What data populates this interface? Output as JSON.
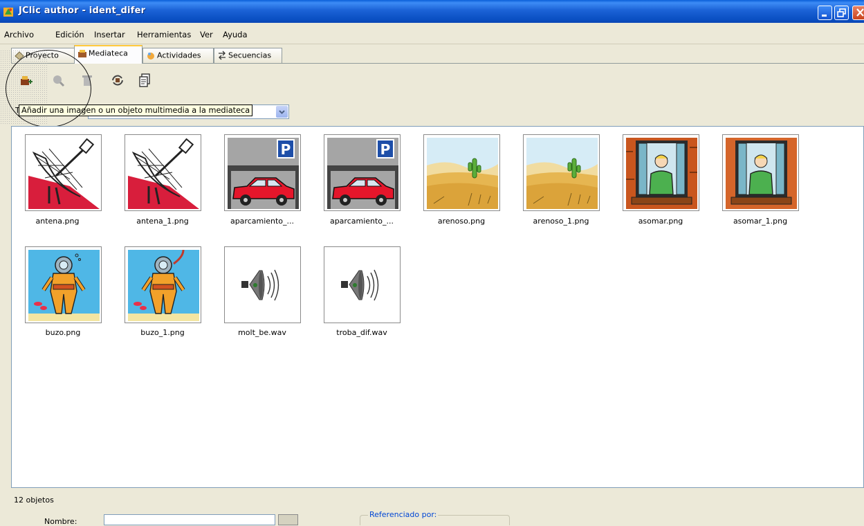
{
  "window": {
    "title": "JClic author - ident_difer"
  },
  "menu": [
    "Archivo",
    "Edición",
    "Insertar",
    "Herramientas",
    "Ver",
    "Ayuda"
  ],
  "tabs": [
    {
      "label": "Proyecto",
      "icon": "project-icon"
    },
    {
      "label": "Mediateca",
      "icon": "media-library-icon",
      "active": true
    },
    {
      "label": "Actividades",
      "icon": "activities-icon"
    },
    {
      "label": "Secuencias",
      "icon": "sequences-icon"
    }
  ],
  "toolbar": {
    "tooltip": "Añadir una imagen o un objeto multimedia a la mediateca",
    "partial_label": "T",
    "tools": [
      "add-media-icon",
      "preview-icon",
      "delete-icon",
      "update-icon",
      "copy-icon"
    ]
  },
  "filter": {
    "selected": ""
  },
  "media": [
    {
      "name": "antena.png",
      "kind": "antenna"
    },
    {
      "name": "antena_1.png",
      "kind": "antenna"
    },
    {
      "name": "aparcamiento_...",
      "kind": "parking"
    },
    {
      "name": "aparcamiento_...",
      "kind": "parking"
    },
    {
      "name": "arenoso.png",
      "kind": "desert"
    },
    {
      "name": "arenoso_1.png",
      "kind": "desert"
    },
    {
      "name": "asomar.png",
      "kind": "window"
    },
    {
      "name": "asomar_1.png",
      "kind": "window"
    },
    {
      "name": "buzo.png",
      "kind": "diver"
    },
    {
      "name": "buzo_1.png",
      "kind": "diver"
    },
    {
      "name": "molt_be.wav",
      "kind": "sound"
    },
    {
      "name": "troba_dif.wav",
      "kind": "sound"
    }
  ],
  "status": {
    "count": "12 objetos"
  },
  "details": {
    "name_label": "Nombre:",
    "referenced_label": "Referenciado por:"
  },
  "colors": {
    "titlebar": "#0a4fc2",
    "panel": "#ece9d8",
    "tooltip": "#ffffe1",
    "tab_accent": "#ffc83c"
  }
}
